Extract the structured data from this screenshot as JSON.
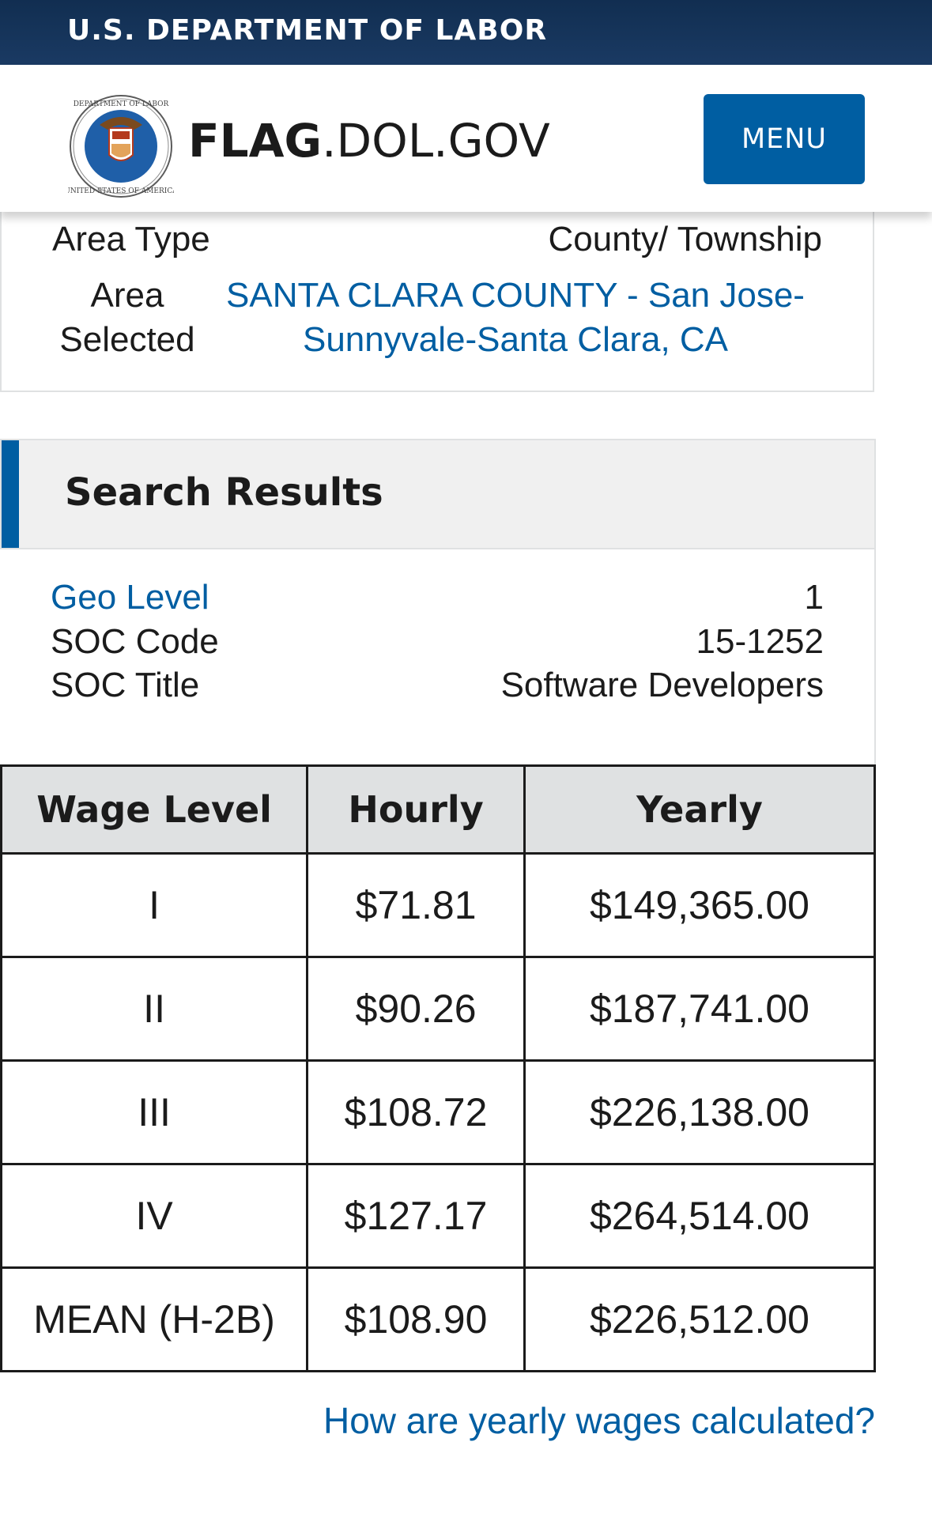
{
  "gov_banner": {
    "text": "U.S. DEPARTMENT OF LABOR"
  },
  "header": {
    "brand_bold": "FLAG",
    "brand_rest": ".DOL.GOV",
    "menu_label": "MENU",
    "seal_icon": "dol-seal-icon"
  },
  "area": {
    "type_label": "Area Type",
    "type_value": "County/ Township",
    "selected_label": "Area Selected",
    "selected_value": "SANTA CLARA COUNTY - San Jose-Sunnyvale-Santa Clara, CA"
  },
  "results": {
    "title": "Search Results",
    "geo_level_label": "Geo Level",
    "geo_level_value": "1",
    "soc_code_label": "SOC Code",
    "soc_code_value": "15-1252",
    "soc_title_label": "SOC Title",
    "soc_title_value": "Software Developers"
  },
  "wage_table": {
    "headers": [
      "Wage Level",
      "Hourly",
      "Yearly"
    ],
    "rows": [
      [
        "I",
        "$71.81",
        "$149,365.00"
      ],
      [
        "II",
        "$90.26",
        "$187,741.00"
      ],
      [
        "III",
        "$108.72",
        "$226,138.00"
      ],
      [
        "IV",
        "$127.17",
        "$264,514.00"
      ],
      [
        "MEAN (H-2B)",
        "$108.90",
        "$226,512.00"
      ]
    ]
  },
  "calc_link": "How are yearly wages calculated?",
  "colors": {
    "navy": "#112e51",
    "primary_blue": "#005ea2",
    "header_gray": "#dfe1e2"
  }
}
